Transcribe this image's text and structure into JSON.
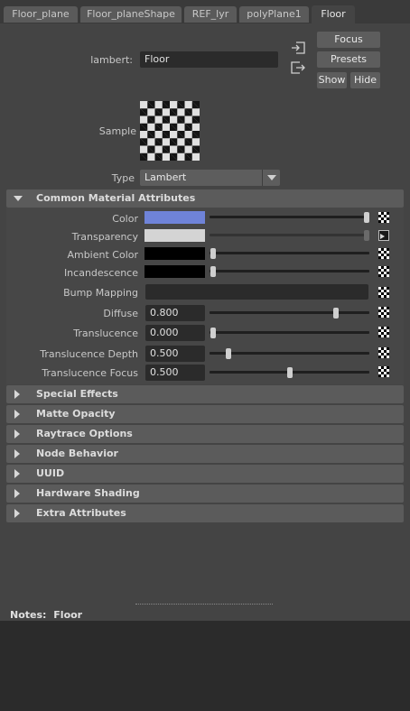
{
  "tabs": [
    "Floor_plane",
    "Floor_planeShape",
    "REF_lyr",
    "polyPlane1",
    "Floor"
  ],
  "header": {
    "shader_label": "lambert:",
    "shader_name": "Floor",
    "focus_label": "Focus",
    "presets_label": "Presets",
    "show_label": "Show",
    "hide_label": "Hide"
  },
  "sample": {
    "label": "Sample"
  },
  "type_field": {
    "label": "Type",
    "value": "Lambert"
  },
  "sections": {
    "common": "Common Material Attributes",
    "collapsed": [
      "Special Effects",
      "Matte Opacity",
      "Raytrace Options",
      "Node Behavior",
      "UUID",
      "Hardware Shading",
      "Extra Attributes"
    ]
  },
  "attributes": {
    "color": {
      "label": "Color",
      "swatch": "#6f83d8",
      "level": 1.0
    },
    "transparency": {
      "label": "Transparency",
      "swatch": "#d4d4d4",
      "level": 1.0
    },
    "ambient_color": {
      "label": "Ambient Color",
      "swatch": "#000000",
      "level": 0.0
    },
    "incandescence": {
      "label": "Incandescence",
      "swatch": "#000000",
      "level": 0.0
    },
    "bump_mapping": {
      "label": "Bump Mapping",
      "value": ""
    },
    "diffuse": {
      "label": "Diffuse",
      "value": "0.800",
      "level": 0.8
    },
    "translucence": {
      "label": "Translucence",
      "value": "0.000",
      "level": 0.0
    },
    "translucence_depth": {
      "label": "Translucence Depth",
      "value": "0.500",
      "level": 0.1
    },
    "translucence_focus": {
      "label": "Translucence Focus",
      "value": "0.500",
      "level": 0.5
    }
  },
  "notes": {
    "label": "Notes:",
    "node": "Floor",
    "text": ""
  },
  "colors": {
    "panel": "#444444",
    "section": "#5b5b5b",
    "field": "#2b2b2b"
  }
}
